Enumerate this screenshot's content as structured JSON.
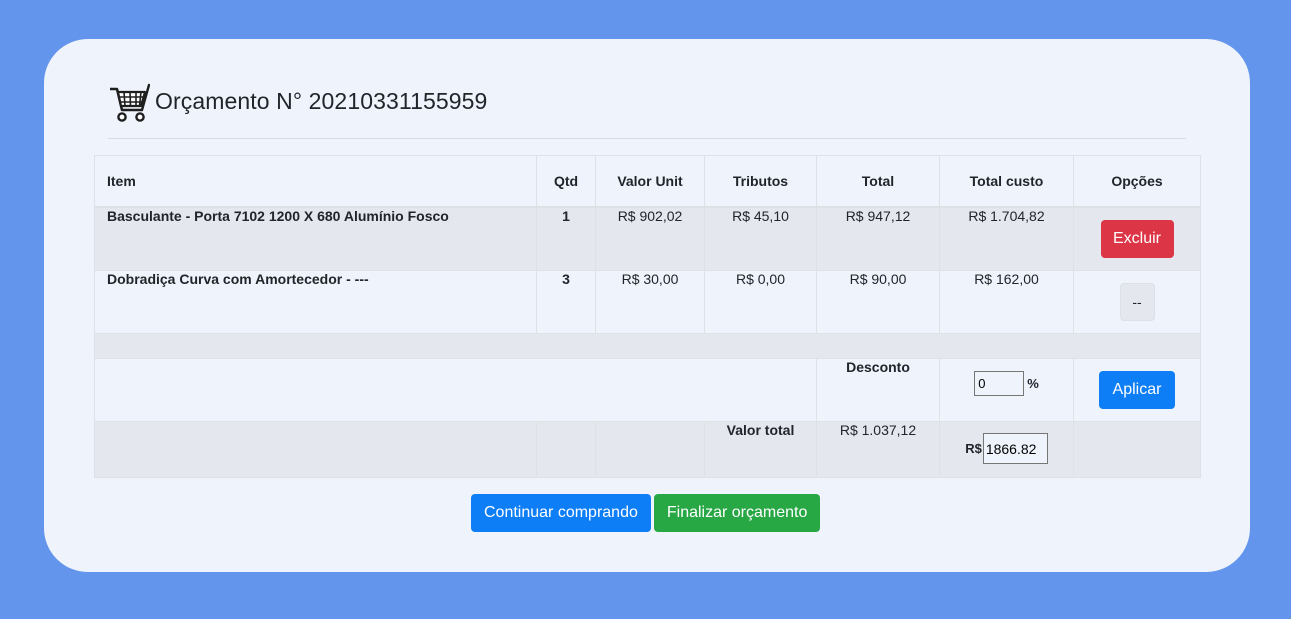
{
  "header": {
    "title": "Orçamento N° 20210331155959",
    "icon": "shopping-cart-icon"
  },
  "table": {
    "columns": [
      "Item",
      "Qtd",
      "Valor Unit",
      "Tributos",
      "Total",
      "Total custo",
      "Opções"
    ],
    "rows": [
      {
        "item": "Basculante - Porta 7102 1200 X 680 Alumínio Fosco",
        "qtd": "1",
        "valor_unit": "R$ 902,02",
        "tributos": "R$ 45,10",
        "total": "R$ 947,12",
        "total_custo": "R$ 1.704,82",
        "option_label": "Excluir"
      },
      {
        "item": "Dobradiça Curva com Amortecedor - ---",
        "qtd": "3",
        "valor_unit": "R$ 30,00",
        "tributos": "R$ 0,00",
        "total": "R$ 90,00",
        "total_custo": "R$ 162,00",
        "option_label": "--"
      }
    ],
    "discount": {
      "label": "Desconto",
      "value": "0",
      "unit": "%",
      "apply_label": "Aplicar"
    },
    "totals": {
      "label": "Valor total",
      "value": "R$ 1.037,12",
      "cost_prefix": "R$",
      "cost_value": "1866.82"
    }
  },
  "footer": {
    "continue_label": "Continuar comprando",
    "finish_label": "Finalizar orçamento"
  },
  "colors": {
    "background": "#6495ed",
    "card": "#eff4fc",
    "danger": "#dc3545",
    "primary": "#0d7ef5",
    "success": "#28a745"
  }
}
